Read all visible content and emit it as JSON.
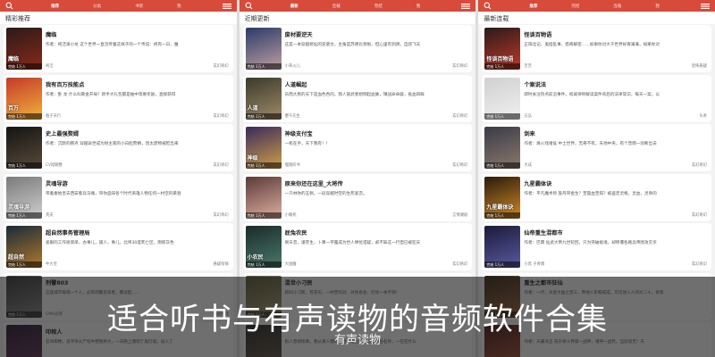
{
  "overlay": {
    "title": "适合听书与有声读物的音频软件合集",
    "subtitle": "有声读物"
  },
  "panels": [
    {
      "tabs": [
        "推荐",
        "分类",
        "书架",
        "我"
      ],
      "active_tab": 0,
      "section_title": "精彩推荐",
      "cards": [
        {
          "cover_text": "魔临",
          "badge": "完结 1万人",
          "title": "魔临",
          "desc": "作者：纯洁滴小龙 这个世界一直流传着这样子的一个传说：终有一日，魔",
          "author": "纯洁",
          "genre": "玄幻奇幻",
          "color1": "#2a1a1a",
          "color2": "#8b2a1a"
        },
        {
          "cover_text": "百万",
          "badge": "完结 1万人",
          "title": "我有百万技能点",
          "desc": "作者：卧 龙 什么叫黄金开局？新手大礼包都是抽中现象奖励，直接获得",
          "author": "瓶子天行",
          "genre": "玄幻奇幻",
          "color1": "#c43a2a",
          "color2": "#f2b23a"
        },
        {
          "cover_text": "",
          "badge": "完结 1万人",
          "title": "史上最强赘婿",
          "desc": "作者：沉默的糕点 穿越异世成为财主家的小白脸赘婿，因太废物被赶出来",
          "author": "CV旭颖整",
          "genre": "玄幻奇幻",
          "color1": "#141414",
          "color2": "#5a4a3a"
        },
        {
          "cover_text": "灵魂导游",
          "badge": "完结 1万人",
          "title": "灵魂导游",
          "desc": "带着秦始皇去西安看兵马俑，带你品味各个时代英雄人物任何一村空的黄昏",
          "author": "英夫",
          "genre": "玄幻奇幻",
          "color1": "#7a7a7a",
          "color2": "#d0d0d0"
        },
        {
          "cover_text": "超自然",
          "badge": "完结 1万人",
          "title": "超自然事务管理局",
          "desc": "爱眼的工作很简单，办事儿，捕人，事儿，北纬30度死亡区，雨练灰色",
          "author": "牛大宝",
          "genre": "悬疑惊悚",
          "color1": "#1a2a3a",
          "color2": "#b07a2a"
        },
        {
          "cover_text": "",
          "badge": "完结 1万人",
          "title": "刑警803",
          "desc": "这座城市每隔一个人，必有刑警名单者，都谈起……",
          "author": "GMG剧演",
          "genre": "悬疑推理",
          "color1": "#3a3a3a",
          "color2": "#8a8a8a"
        },
        {
          "cover_text": "",
          "badge": "",
          "title": "叩棺人",
          "desc": "您叫柳楼，说爷爷从尸棺中把我养大，一天晚上遇到了鬼打墙，误入了",
          "author": "",
          "genre": "",
          "color1": "#2a1a3a",
          "color2": "#6a3a5a"
        }
      ]
    },
    {
      "tabs": [
        "最新",
        "连载",
        "完结",
        "我"
      ],
      "active_tab": 0,
      "section_title": "近期更新",
      "cards": [
        {
          "cover_text": "",
          "badge": "完结 1万人",
          "title": "废材要逆天",
          "desc": "这是一本穿越修仙的逆袭文，主角是苏佛比草根，但心里有洞阴，自叔飞天",
          "author": "小草火儿",
          "genre": "玄幻奇幻",
          "color1": "#2a3a6a",
          "color2": "#c0a0a0"
        },
        {
          "cover_text": "人道",
          "badge": "完结 1万人",
          "title": "人道崛起",
          "desc": "乐而大民的天下是血色色的，我人族武者想倒起血脉，镇战命命骏，抵血四鲜",
          "author": "塞午先生",
          "genre": "玄幻奇幻",
          "color1": "#3a3a2a",
          "color2": "#a08a6a"
        },
        {
          "cover_text": "神级",
          "badge": "完结 1万人",
          "title": "神级支付宝",
          "desc": "一机在手，天下我有！！",
          "author": "慢跑听书",
          "genre": "玄幻奇幻",
          "color1": "#3a2a5a",
          "color2": "#d0a04a"
        },
        {
          "cover_text": "",
          "badge": "完结 1万人",
          "title": "原来你还在这里_大将传",
          "desc": "一只林你的玉佩，一段穿越时空的生死爱恋。",
          "author": "小暖机",
          "genre": "言情潮剧",
          "color1": "#5a3a3a",
          "color2": "#e0b0a0"
        },
        {
          "cover_text": "小农民",
          "badge": "完结 1万人",
          "title": "屁兔农民",
          "desc": "窝天音，谨苍生，卜算一字露成为世人绵忧诺疑，却不知这一行但已被犯天",
          "author": "大国魔",
          "genre": "玄幻奇幻",
          "color1": "#1a2a2a",
          "color2": "#4a7a6a"
        },
        {
          "cover_text": "",
          "badge": "完结 1万人",
          "title": "混世小刁民",
          "desc": "新叫小刁民，苍苍天，一村苦的对，对各各各，打仗一本不够！",
          "author": "",
          "genre": "",
          "color1": "#5a5a3a",
          "color2": "#b0a07a"
        },
        {
          "cover_text": "",
          "badge": "",
          "title": "",
          "desc": "别人曾修修真，我从真人都修的直，把生的话语，各各名师，一在吃什么",
          "author": "",
          "genre": "",
          "color1": "#2a2a2a",
          "color2": "#6a5a4a"
        }
      ]
    },
    {
      "tabs": [
        "推荐",
        "完结",
        "连载",
        "我"
      ],
      "active_tab": 0,
      "section_title": "最新连载",
      "cards": [
        {
          "cover_text": "怪谈百物语",
          "badge": "完结 1万人",
          "title": "怪谈百物语",
          "desc": "正阳北记、鬼怪乱事、猎奇解密……如果你对大千世界好奇满满，如果你对",
          "author": "苦苦",
          "genre": "恐怖悬疑",
          "color1": "#2a1a1a",
          "color2": "#c03a2a"
        },
        {
          "cover_text": "",
          "badge": "完结 1万人",
          "title": "个案说法",
          "desc": "即时关注热点前沿事件，权威律师解读案件背后的法律常识，每天一案，以",
          "author": "方弘",
          "genre": "头条",
          "color1": "#d0d0d0",
          "color2": "#f0f0f0"
        },
        {
          "cover_text": "",
          "badge": "完结 1万人",
          "title": "剑来",
          "desc": "作者：烽火戏诸侯 中土世界，无奇不有。天地中央，有个普雨一剑断出去",
          "author": "大成",
          "genre": "玄幻奇幻",
          "color1": "#3a3a4a",
          "color2": "#8a7a6a"
        },
        {
          "cover_text": "九星霸体诀",
          "badge": "完结 1万人",
          "title": "九星霸体诀",
          "desc": "作者：平凡魔术师 旋丹带金生？至殷血至阳？被盗走灵根，灵血，灵骨的",
          "author": "",
          "genre": "玄幻奇幻",
          "color1": "#2a1a0a",
          "color2": "#d08a2a"
        },
        {
          "cover_text": "",
          "badge": "完结 1万人",
          "title": "仙帝重生混都市",
          "desc": "作者：巴霄 仙武大帝九世轮回，只为突破极境，却惨遭各路兵帝围攻灭亲",
          "author": "小黑 子青啸",
          "genre": "玄幻奇幻",
          "color1": "#1a1a3a",
          "color2": "#5a5aa0"
        },
        {
          "cover_text": "",
          "badge": "完结 1万人",
          "title": "重生之都市狂仙",
          "desc": "作者：一代，天武大陆之至三，帝地人形物成成。可可进入人间大二十，修炼",
          "author": "",
          "genre": "",
          "color1": "#3a2a1a",
          "color2": "#a06a3a"
        },
        {
          "cover_text": "",
          "badge": "",
          "title": "",
          "desc": "作者：天冀冰王 前于修十界第一战神，诸神一战死，当前境无！天",
          "author": "",
          "genre": "",
          "color1": "#4a1a1a",
          "color2": "#b05a3a"
        }
      ]
    }
  ]
}
